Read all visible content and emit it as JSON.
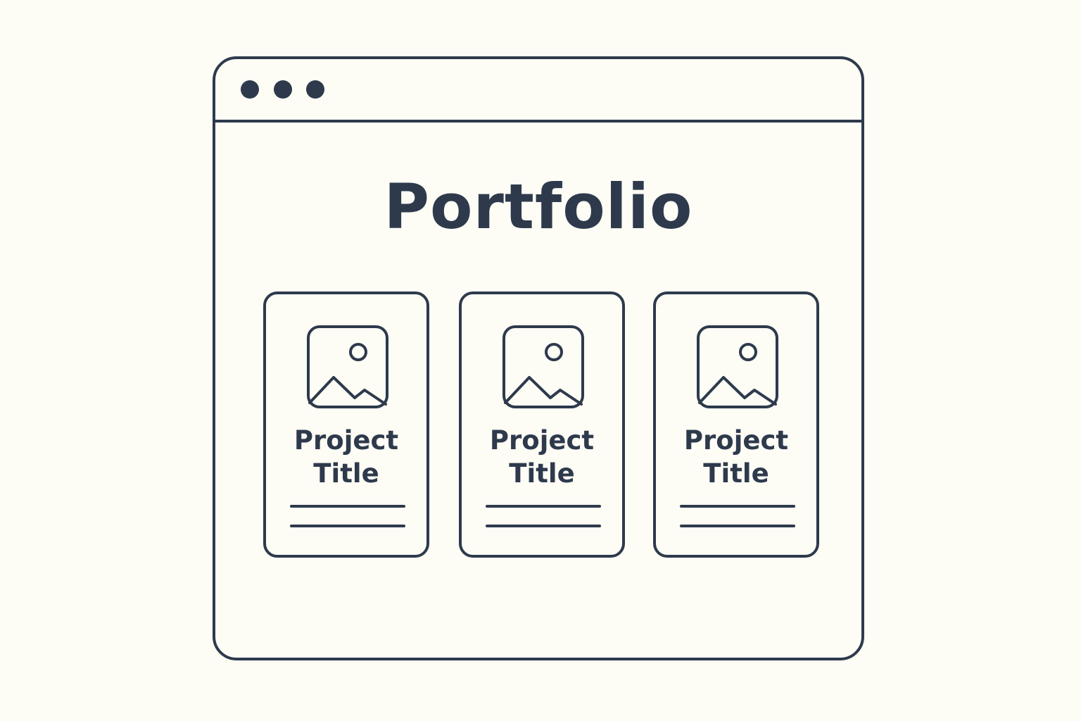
{
  "window": {
    "dots": [
      "window-dot",
      "window-dot",
      "window-dot"
    ]
  },
  "page": {
    "title": "Portfolio"
  },
  "cards": [
    {
      "title": "Project\nTitle",
      "icon": "image-placeholder-icon"
    },
    {
      "title": "Project\nTitle",
      "icon": "image-placeholder-icon"
    },
    {
      "title": "Project\nTitle",
      "icon": "image-placeholder-icon"
    }
  ],
  "colors": {
    "background": "#fdfcf5",
    "stroke": "#2e3a4c"
  }
}
